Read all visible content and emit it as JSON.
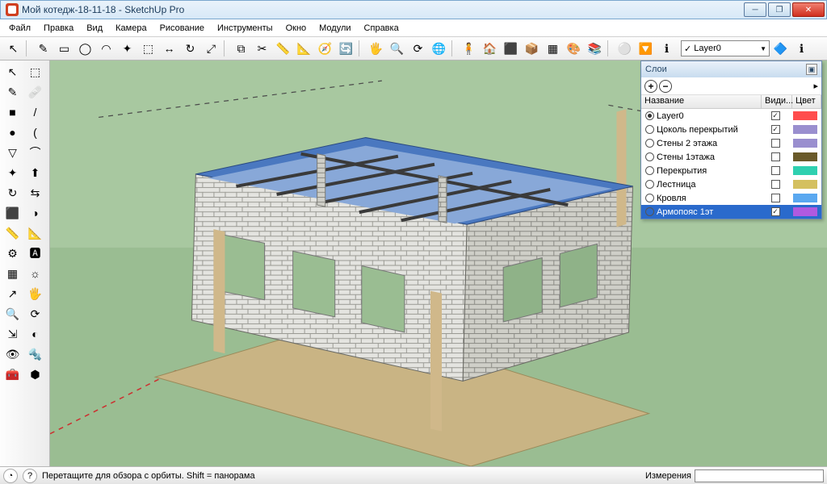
{
  "window": {
    "title": "Мой котедж-18-11-18 - SketchUp Pro"
  },
  "menu": [
    "Файл",
    "Правка",
    "Вид",
    "Камера",
    "Рисование",
    "Инструменты",
    "Окно",
    "Модули",
    "Справка"
  ],
  "layer_dropdown": {
    "value": "Layer0"
  },
  "layers_panel": {
    "title": "Слои",
    "columns": {
      "name": "Название",
      "visible": "Види...",
      "color": "Цвет"
    },
    "rows": [
      {
        "name": "Layer0",
        "active": true,
        "visible": true,
        "color": "#ff4d4d"
      },
      {
        "name": "Цоколь перекрытий",
        "active": false,
        "visible": true,
        "color": "#9a8fcf"
      },
      {
        "name": "Стены 2 этажа",
        "active": false,
        "visible": false,
        "color": "#9a8fcf"
      },
      {
        "name": "Стены 1этажа",
        "active": false,
        "visible": false,
        "color": "#6a5a2a"
      },
      {
        "name": "Перекрытия",
        "active": false,
        "visible": false,
        "color": "#2fd0b0"
      },
      {
        "name": "Лестница",
        "active": false,
        "visible": false,
        "color": "#d4c060"
      },
      {
        "name": "Кровля",
        "active": false,
        "visible": false,
        "color": "#5aa8f0"
      },
      {
        "name": "Армопояс 1эт",
        "active": false,
        "visible": true,
        "color": "#b05ae0",
        "selected": true
      }
    ]
  },
  "status": {
    "hint": "Перетащите для обзора с орбиты.  Shift = панорама",
    "measure_label": "Измерения"
  },
  "icons": {
    "tb": [
      "↖",
      "✎",
      "▭",
      "◯",
      "◠",
      "✦",
      "⬚",
      "↔",
      "↻",
      "⤢",
      "⧉",
      "✂",
      "📏",
      "📐",
      "🧭",
      "🔄",
      "🖐",
      "🔍",
      "⟳",
      "🌐",
      "🧍",
      "🏠",
      "⬛",
      "📦",
      "▦",
      "🎨",
      "📚",
      "⚪",
      "🔽",
      "ℹ"
    ],
    "tray": [
      "↖",
      "⬚",
      "✎",
      "🩹",
      "■",
      "/",
      "●",
      "(",
      "▽",
      "⌒",
      "✦",
      "⬆",
      "↻",
      "⇆",
      "⬛",
      "◑",
      "📏",
      "📐",
      "⚙",
      "🅰",
      "▦",
      "☼",
      "↗",
      "🖐",
      "🔍",
      "⟳",
      "⇲",
      "◐",
      "👁",
      "🔩",
      "🧰",
      "⬢"
    ]
  }
}
